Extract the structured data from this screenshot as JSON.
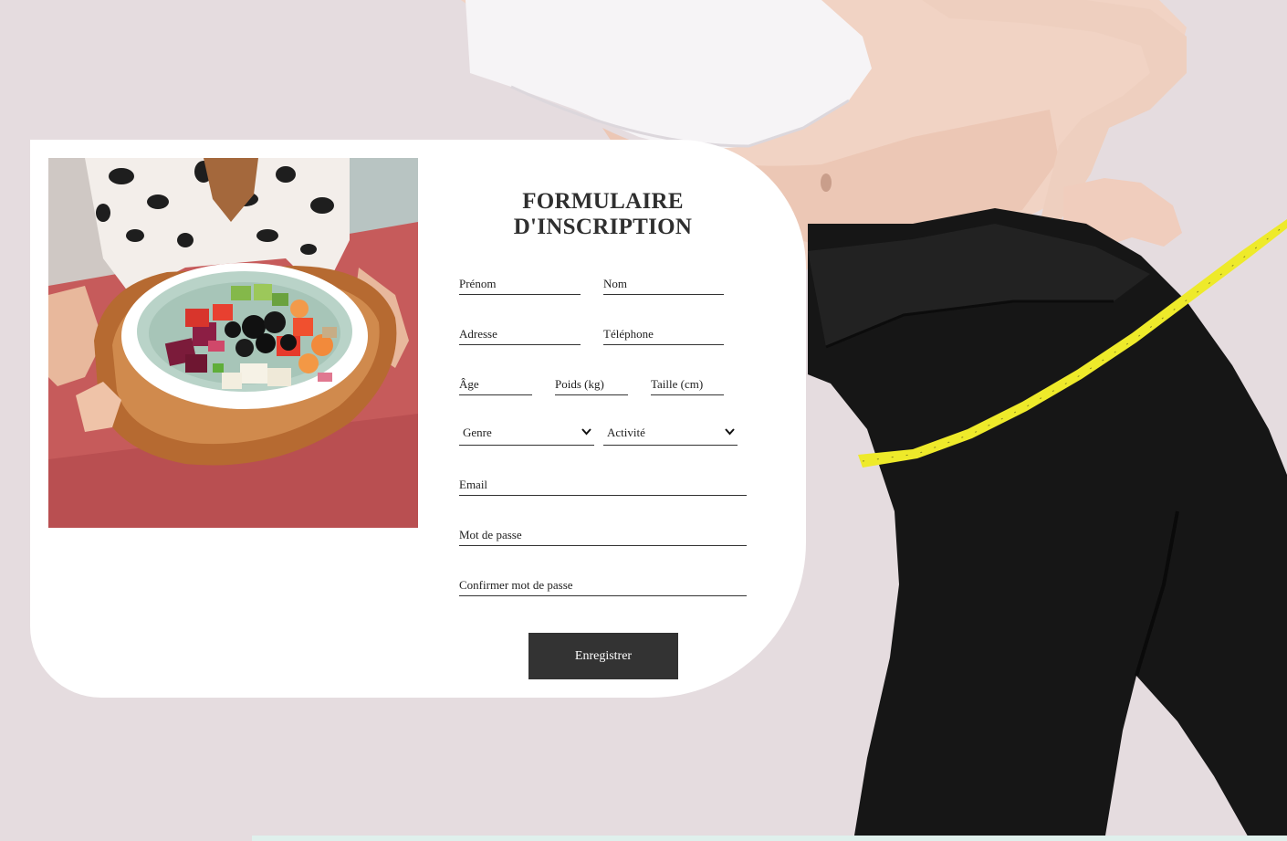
{
  "form": {
    "title": "FORMULAIRE D'INSCRIPTION",
    "fields": {
      "prenom": "Prénom",
      "nom": "Nom",
      "adresse": "Adresse",
      "telephone": "Téléphone",
      "age": "Âge",
      "poids": "Poids (kg)",
      "taille": "Taille (cm)",
      "email": "Email",
      "mot_de_passe": "Mot de passe",
      "confirmer": "Confirmer mot de passe"
    },
    "selects": {
      "genre": "Genre",
      "activite": "Activité"
    },
    "submit_label": "Enregistrer"
  },
  "theme": {
    "background": "#e5dcdf",
    "card": "#ffffff",
    "button": "#333333",
    "button_text": "#ffffff",
    "tape": "#eeea2a"
  },
  "icons": {
    "select_arrow": "chevron-down-icon"
  }
}
